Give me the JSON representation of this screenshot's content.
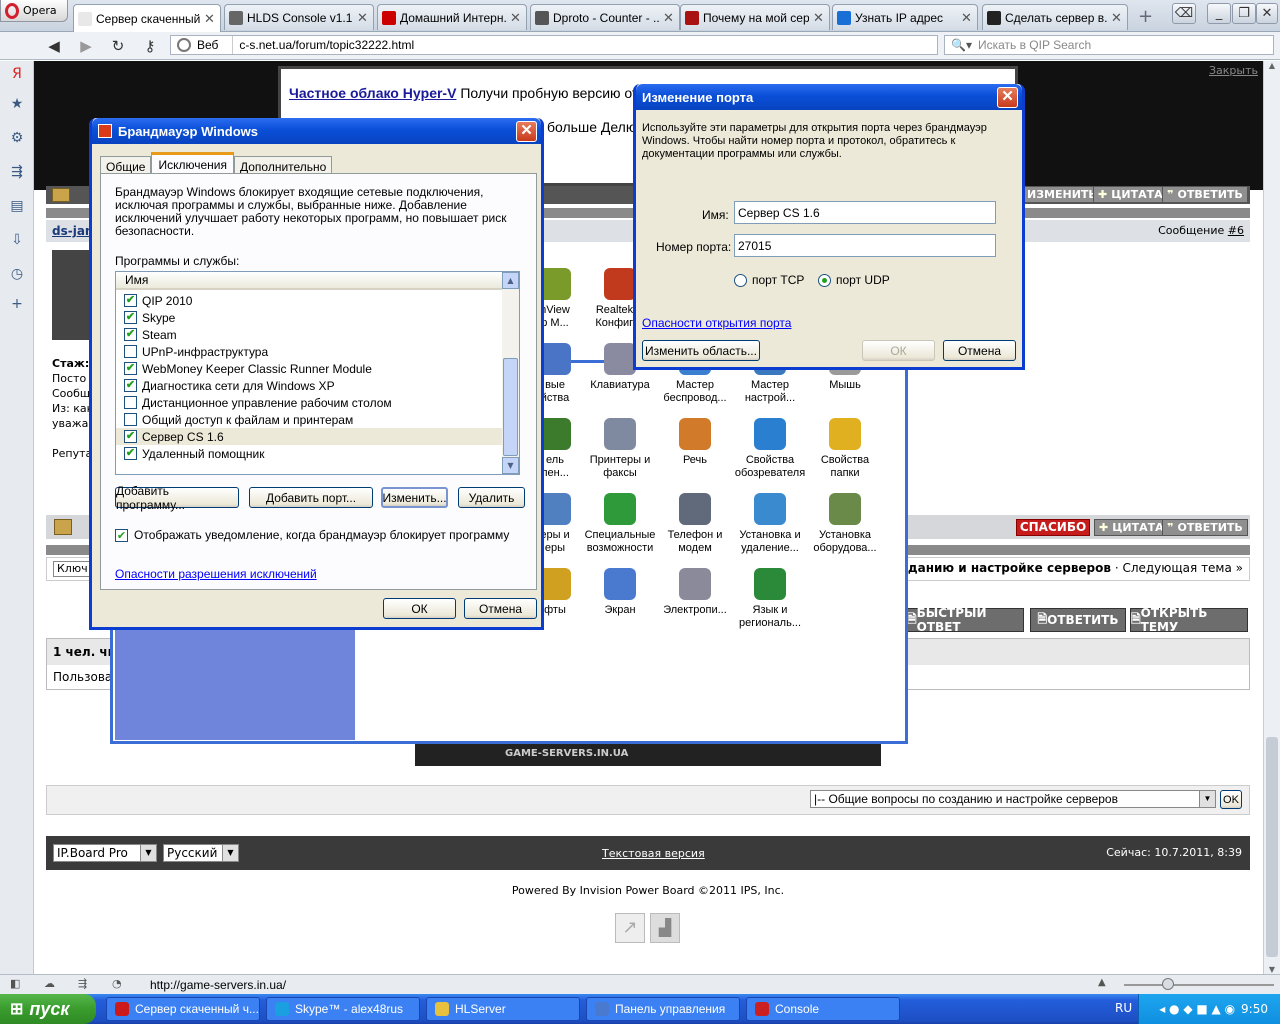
{
  "browser": {
    "menu_label": "Opera",
    "tabs": [
      {
        "title": "Сервер скаченный ...",
        "color": "#e8e8e8"
      },
      {
        "title": "HLDS Console v1.1 ...",
        "color": "#666666"
      },
      {
        "title": "Домашний Интерн...",
        "color": "#cc0000"
      },
      {
        "title": "Dproto - Counter - ...",
        "color": "#555555"
      },
      {
        "title": "Почему на мой сер...",
        "color": "#aa1111"
      },
      {
        "title": "Узнать IP адрес",
        "color": "#1a6fd6"
      },
      {
        "title": "Сделать сервер в...",
        "color": "#222222"
      }
    ],
    "address_scope": "Веб",
    "address_url": "c-s.net.ua/forum/topic32222.html",
    "search_placeholder": "Искать в QIP Search",
    "status_url": "http://game-servers.in.ua/"
  },
  "ad": {
    "link_text": "Частное облако Hyper-V",
    "text": "Получи пробную версию от Mi",
    "text2": "больше Делю",
    "close_label": "Закрыть"
  },
  "forum": {
    "user_name": "ds-jan",
    "message_label": "Сообщение",
    "message_num": "#6",
    "edit_label": "ИЗМЕНИТЬ",
    "quote_label": "ЦИТАТА",
    "reply_label": "ОТВЕТИТЬ",
    "thanks_label": "СПАСИБО",
    "profile_lines": [
      "Стаж:",
      "Посто",
      "Сообщ",
      "Из: как",
      "уважае",
      "Репута"
    ],
    "keyword_label": "Ключ",
    "next_topic_text": "ы по созданию и настройке серверов",
    "next_topic_link": "· Следующая тема »",
    "fast_reply": "БЫСТРЫЙ ОТВЕТ",
    "reply_big": "ОТВЕТИТЬ",
    "open_topic": "ОТКРЫТЬ ТЕМУ",
    "readers_label": "1 чел. чита",
    "users_label": "Пользоват",
    "banner_text": "GAME-SERVERS.IN.UA",
    "forum_select": "|-- Общие вопросы по созданию и настройке серверов",
    "ok_label": "OK",
    "skin_select": "IP.Board Pro",
    "lang_select": "Русский",
    "text_version": "Текстовая версия",
    "now_label": "Сейчас: 10.7.2011, 8:39",
    "powered": "Powered By Invision Power Board  ©2011  IPS, Inc."
  },
  "control_panel": {
    "items": [
      {
        "label": "nView\np M...",
        "color": "#7a9a2a"
      },
      {
        "label": "Realtek H\nКонфигур",
        "color": "#c23a1e"
      },
      {
        "label": "вые\nйства",
        "color": "#4a74c6"
      },
      {
        "label": "Клавиатура",
        "color": "#8a8aa0"
      },
      {
        "label": "Мастер\nбеспровод...",
        "color": "#3b7fd0"
      },
      {
        "label": "Мастер\nнастрой...",
        "color": "#3a78c0"
      },
      {
        "label": "Мышь",
        "color": "#9a9a9a"
      },
      {
        "label": "ель\nлен...",
        "color": "#3c7a2c"
      },
      {
        "label": "Принтеры и\nфаксы",
        "color": "#7f8aa0"
      },
      {
        "label": "Речь",
        "color": "#d07a2a"
      },
      {
        "label": "Свойства\nобозревателя",
        "color": "#2a7fd0"
      },
      {
        "label": "Свойства\nпапки",
        "color": "#e0b020"
      },
      {
        "label": "еры и\nеры",
        "color": "#5080c0"
      },
      {
        "label": "Специальные\nвозможности",
        "color": "#2f9a3a"
      },
      {
        "label": "Телефон и\nмодем",
        "color": "#606a7a"
      },
      {
        "label": "Установка и\nудаление...",
        "color": "#3a8ad0"
      },
      {
        "label": "Установка\nоборудова...",
        "color": "#6a8a4a"
      },
      {
        "label": "фты",
        "color": "#d0a020"
      },
      {
        "label": "Экран",
        "color": "#4a7ad0"
      },
      {
        "label": "Электропи...",
        "color": "#8a8a9a"
      },
      {
        "label": "Язык и\nрегиональ...",
        "color": "#2a8a3a"
      }
    ]
  },
  "firewall": {
    "title": "Брандмауэр Windows",
    "tabs": [
      "Общие",
      "Исключения",
      "Дополнительно"
    ],
    "description": "Брандмауэр Windows блокирует входящие сетевые подключения, исключая программы и службы, выбранные ниже. Добавление исключений улучшает работу некоторых программ, но повышает риск безопасности.",
    "list_label": "Программы и службы:",
    "column_header": "Имя",
    "programs": [
      {
        "name": "QIP 2010",
        "checked": true
      },
      {
        "name": "Skype",
        "checked": true
      },
      {
        "name": "Steam",
        "checked": true
      },
      {
        "name": "UPnP-инфраструктура",
        "checked": false
      },
      {
        "name": "WebMoney Keeper Classic Runner Module",
        "checked": true
      },
      {
        "name": "Диагностика сети для Windows XP",
        "checked": true
      },
      {
        "name": "Дистанционное управление рабочим столом",
        "checked": false
      },
      {
        "name": "Общий доступ к файлам и принтерам",
        "checked": false
      },
      {
        "name": "Сервер CS 1.6",
        "checked": true
      },
      {
        "name": "Удаленный помощник",
        "checked": true
      }
    ],
    "add_program": "Добавить программу...",
    "add_port": "Добавить порт...",
    "edit": "Изменить...",
    "delete": "Удалить",
    "notify_label": "Отображать уведомление, когда брандмауэр блокирует программу",
    "notify_checked": true,
    "risk_link": "Опасности разрешения исключений",
    "ok": "ОК",
    "cancel": "Отмена"
  },
  "port_dialog": {
    "title": "Изменение порта",
    "description": "Используйте эти параметры для открытия порта через брандмауэр Windows. Чтобы найти номер порта и протокол, обратитесь к документации программы или службы.",
    "name_label": "Имя:",
    "name_value": "Сервер CS 1.6",
    "port_label": "Номер порта:",
    "port_value": "27015",
    "tcp_label": "порт TCP",
    "udp_label": "порт UDP",
    "selected_protocol": "UDP",
    "risk_link": "Опасности открытия порта",
    "change_scope": "Изменить область...",
    "ok": "ОК",
    "cancel": "Отмена"
  },
  "taskbar": {
    "start_label": "пуск",
    "items": [
      {
        "label": "Сервер скаченный ч...",
        "color": "#cc1a1a"
      },
      {
        "label": "Skype™ - alex48rus",
        "color": "#1aa0e0"
      },
      {
        "label": "HLServer",
        "color": "#e8c040"
      },
      {
        "label": "Панель управления",
        "color": "#4a7ad0"
      },
      {
        "label": "Console",
        "color": "#cc2020"
      }
    ],
    "lang": "RU",
    "clock": "9:50"
  }
}
